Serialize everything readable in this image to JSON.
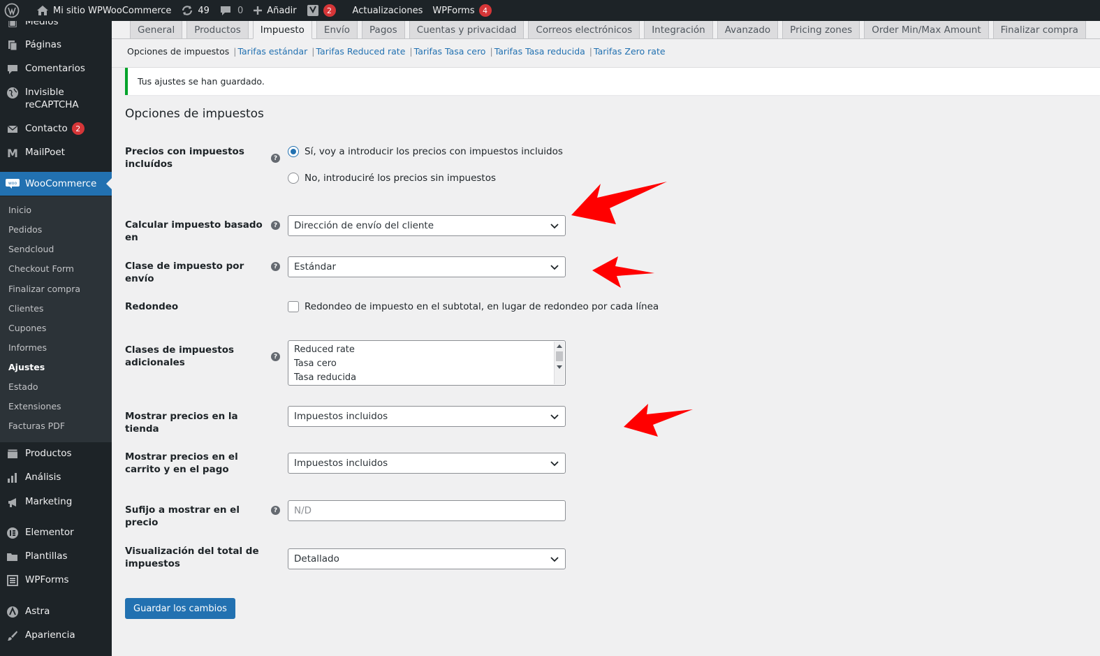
{
  "colors": {
    "adminbar_bg": "#1d2327",
    "accent": "#2271b1",
    "badge": "#d63638",
    "notice_border": "#00a32a",
    "arrow": "#ff0000"
  },
  "adminbar": {
    "site_name": "Mi sitio WPWooCommerce",
    "updates_count": "49",
    "comments_count": "0",
    "add_label": "Añadir",
    "yoast_badge": "2",
    "updates_label": "Actualizaciones",
    "wpforms_label": "WPForms",
    "wpforms_badge": "4"
  },
  "sidebar": {
    "items": [
      {
        "label": "Medios",
        "icon": "media-icon"
      },
      {
        "label": "Páginas",
        "icon": "pages-icon"
      },
      {
        "label": "Comentarios",
        "icon": "comments-icon"
      },
      {
        "label": "Invisible reCAPTCHA",
        "icon": "globe-icon"
      },
      {
        "label": "Contacto",
        "icon": "mail-icon",
        "badge": "2"
      },
      {
        "label": "MailPoet",
        "icon": "mailpoet-icon"
      },
      {
        "label": "WooCommerce",
        "icon": "woo-icon"
      },
      {
        "label": "Productos",
        "icon": "products-icon"
      },
      {
        "label": "Análisis",
        "icon": "chart-icon"
      },
      {
        "label": "Marketing",
        "icon": "megaphone-icon"
      },
      {
        "label": "Elementor",
        "icon": "elementor-icon"
      },
      {
        "label": "Plantillas",
        "icon": "folder-icon"
      },
      {
        "label": "WPForms",
        "icon": "forms-icon"
      },
      {
        "label": "Astra",
        "icon": "astra-icon"
      },
      {
        "label": "Apariencia",
        "icon": "brush-icon"
      }
    ],
    "submenu": [
      "Inicio",
      "Pedidos",
      "Sendcloud",
      "Checkout Form",
      "Finalizar compra",
      "Clientes",
      "Cupones",
      "Informes",
      "Ajustes",
      "Estado",
      "Extensiones",
      "Facturas PDF"
    ]
  },
  "tabs": [
    "General",
    "Productos",
    "Impuesto",
    "Envío",
    "Pagos",
    "Cuentas y privacidad",
    "Correos electrónicos",
    "Integración",
    "Avanzado",
    "Pricing zones",
    "Order Min/Max Amount",
    "Finalizar compra"
  ],
  "subsub": {
    "current": "Opciones de impuestos",
    "links": [
      "Tarifas estándar",
      "Tarifas Reduced rate",
      "Tarifas Tasa cero",
      "Tarifas Tasa reducida",
      "Tarifas Zero rate"
    ]
  },
  "notice": "Tus ajustes se han guardado.",
  "section_title": "Opciones de impuestos",
  "form": {
    "prices_label": "Precios con impuestos incluídos",
    "prices_yes": "Sí, voy a introducir los precios con impuestos incluidos",
    "prices_no": "No, introduciré los precios sin impuestos",
    "calc_label": "Calcular impuesto basado en",
    "calc_value": "Dirección de envío del cliente",
    "shipping_class_label": "Clase de impuesto por envío",
    "shipping_class_value": "Estándar",
    "rounding_label": "Redondeo",
    "rounding_text": "Redondeo de impuesto en el subtotal, en lugar de redondeo por cada línea",
    "additional_label": "Clases de impuestos adicionales",
    "additional_options": [
      "Reduced rate",
      "Tasa cero",
      "Tasa reducida"
    ],
    "shop_display_label": "Mostrar precios en la tienda",
    "shop_display_value": "Impuestos incluidos",
    "cart_display_label": "Mostrar precios en el carrito y en el pago",
    "cart_display_value": "Impuestos incluidos",
    "suffix_label": "Sufijo a mostrar en el precio",
    "suffix_placeholder": "N/D",
    "total_display_label": "Visualización del total de impuestos",
    "total_display_value": "Detallado",
    "help_glyph": "?"
  },
  "save_button": "Guardar los cambios"
}
